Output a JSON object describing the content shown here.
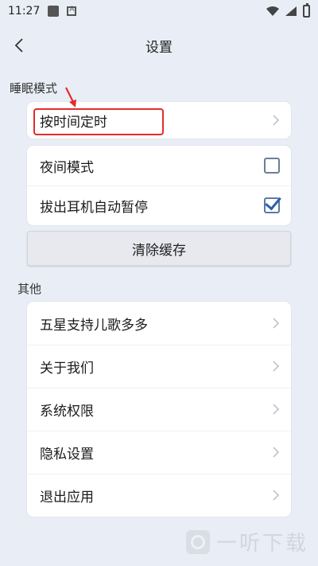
{
  "status": {
    "time": "11:27"
  },
  "header": {
    "title": "设置"
  },
  "sleep_section": {
    "label": "睡眠模式",
    "timer_item": "按时间定时"
  },
  "toggles": [
    {
      "label": "夜间模式",
      "checked": false
    },
    {
      "label": "拔出耳机自动暂停",
      "checked": true
    }
  ],
  "clear_cache": {
    "label": "清除缓存"
  },
  "other_section": {
    "label": "其他",
    "items": [
      {
        "label": "五星支持儿歌多多"
      },
      {
        "label": "关于我们"
      },
      {
        "label": "系统权限"
      },
      {
        "label": "隐私设置"
      },
      {
        "label": "退出应用"
      }
    ]
  },
  "watermark": {
    "text": "一听下载"
  },
  "colors": {
    "background": "#e9eef6",
    "highlight": "#e52b2b",
    "checkbox": "#2f5ea8"
  }
}
